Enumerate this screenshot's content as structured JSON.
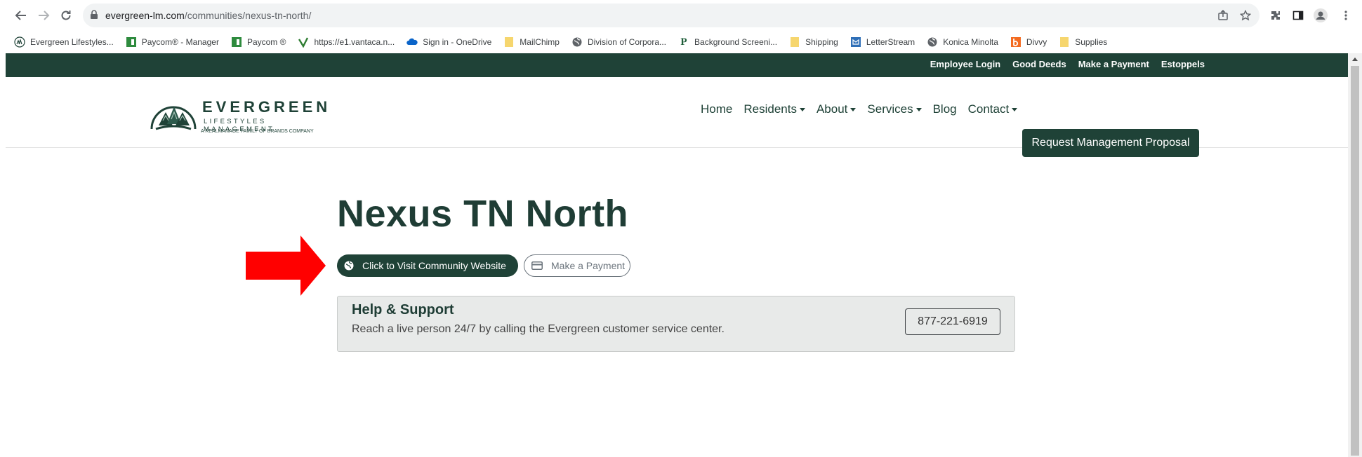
{
  "browser": {
    "url_host": "evergreen-lm.com",
    "url_path": "/communities/nexus-tn-north/"
  },
  "bookmarks": [
    {
      "label": "Evergreen Lifestyles...",
      "icon": "evergreen-icon"
    },
    {
      "label": "Paycom® - Manager",
      "icon": "paycom-icon"
    },
    {
      "label": "Paycom ®",
      "icon": "paycom-icon"
    },
    {
      "label": "https://e1.vantaca.n...",
      "icon": "vantaca-icon"
    },
    {
      "label": "Sign in - OneDrive",
      "icon": "onedrive-icon"
    },
    {
      "label": "MailChimp",
      "icon": "folder-icon"
    },
    {
      "label": "Division of Corpora...",
      "icon": "globe-icon"
    },
    {
      "label": "Background Screeni...",
      "icon": "p-icon"
    },
    {
      "label": "Shipping",
      "icon": "folder-icon"
    },
    {
      "label": "LetterStream",
      "icon": "letterstream-icon"
    },
    {
      "label": "Konica Minolta",
      "icon": "globe-icon"
    },
    {
      "label": "Divvy",
      "icon": "divvy-icon"
    },
    {
      "label": "Supplies",
      "icon": "folder-icon"
    }
  ],
  "topbar": {
    "links": [
      "Employee Login",
      "Good Deeds",
      "Make a Payment",
      "Estoppels"
    ]
  },
  "logo": {
    "word": "EVERGREEN",
    "sub": "LIFESTYLES MANAGEMENT",
    "tag": "A REALMANAGE FAMILY OF BRANDS COMPANY"
  },
  "nav": {
    "home": "Home",
    "residents": "Residents",
    "about": "About",
    "services": "Services",
    "blog": "Blog",
    "contact": "Contact",
    "cta": "Request Management Proposal"
  },
  "page": {
    "title": "Nexus TN North",
    "visit_label": "Click to Visit Community Website",
    "pay_label": "Make a Payment"
  },
  "support": {
    "title": "Help & Support",
    "desc": "Reach a live person 24/7 by calling the Evergreen customer service center.",
    "phone": "877-221-6919"
  },
  "colors": {
    "brand_dark_green": "#1f4237",
    "annotation_red": "#ff0000"
  }
}
